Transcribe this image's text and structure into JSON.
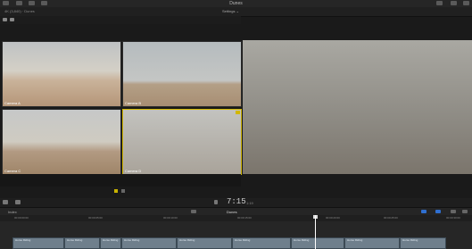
{
  "window": {
    "title": "Dunes",
    "format": "4K (3,840) · Dunes"
  },
  "viewer": {
    "settings_label": "Settings ⌄"
  },
  "angles": [
    {
      "label": "Camera A",
      "active": false
    },
    {
      "label": "Camera B",
      "active": false
    },
    {
      "label": "Camera C",
      "active": false
    },
    {
      "label": "Camera D",
      "active": true
    }
  ],
  "timeline": {
    "timecode": "7:15",
    "timecode_sub": "1:19",
    "index_label": "Index",
    "project_name": "Dunes",
    "ruler_ticks": [
      "00:00:00:00",
      "00:00:05:00",
      "00:00:10:00",
      "00:00:15:00",
      "00:00:20:00",
      "00:00:25:00",
      "00:00:30:00"
    ],
    "clip_names": [
      "Horse Riding",
      "Horse Riding",
      "Horse Riding",
      "Horse Riding",
      "Horse Riding",
      "Horse Riding",
      "Horse Riding",
      "Horse Riding",
      "Horse Riding"
    ]
  },
  "colors": {
    "accent": "#d2b700",
    "playhead": "#ffffff"
  }
}
